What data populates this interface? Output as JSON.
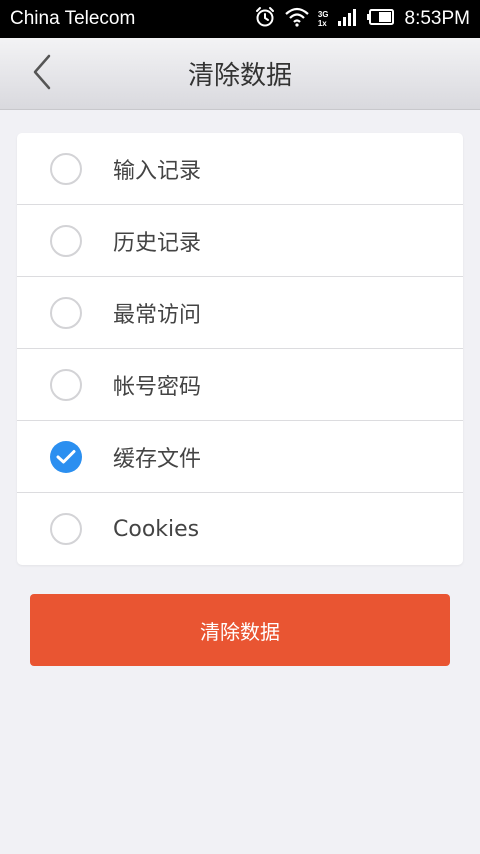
{
  "status_bar": {
    "carrier": "China Telecom",
    "time": "8:53PM",
    "net_3g": "3G",
    "net_1x": "1x",
    "icons": [
      "alarm-icon",
      "wifi-icon",
      "signal-icon",
      "battery-icon"
    ]
  },
  "header": {
    "title": "清除数据",
    "back_icon": "chevron-left-icon"
  },
  "options": [
    {
      "label": "输入记录",
      "checked": false
    },
    {
      "label": "历史记录",
      "checked": false
    },
    {
      "label": "最常访问",
      "checked": false
    },
    {
      "label": "帐号密码",
      "checked": false
    },
    {
      "label": "缓存文件",
      "checked": true
    },
    {
      "label": "Cookies",
      "checked": false
    }
  ],
  "actions": {
    "clear_label": "清除数据"
  },
  "colors": {
    "accent": "#2b8ff0",
    "danger": "#e95532"
  }
}
